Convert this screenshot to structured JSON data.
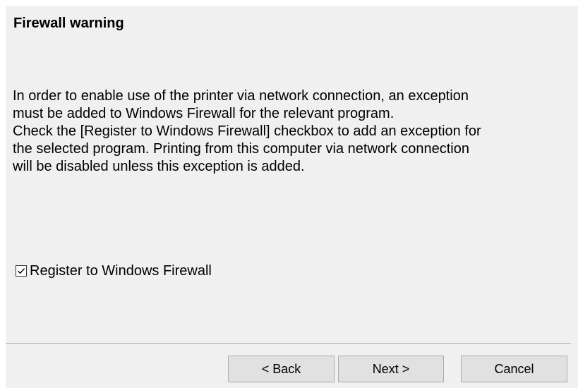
{
  "dialog": {
    "title": "Firewall warning",
    "message_lines": [
      "In order to enable use of the printer via network connection, an exception",
      "must be added to Windows Firewall for the relevant program.",
      "Check the [Register to Windows Firewall] checkbox to add an exception for",
      "the selected program. Printing from this computer via network connection",
      "will be disabled unless this exception is added."
    ],
    "checkbox": {
      "label": "Register to Windows Firewall",
      "checked": true
    },
    "buttons": {
      "back": "< Back",
      "next": "Next >",
      "cancel": "Cancel"
    }
  }
}
